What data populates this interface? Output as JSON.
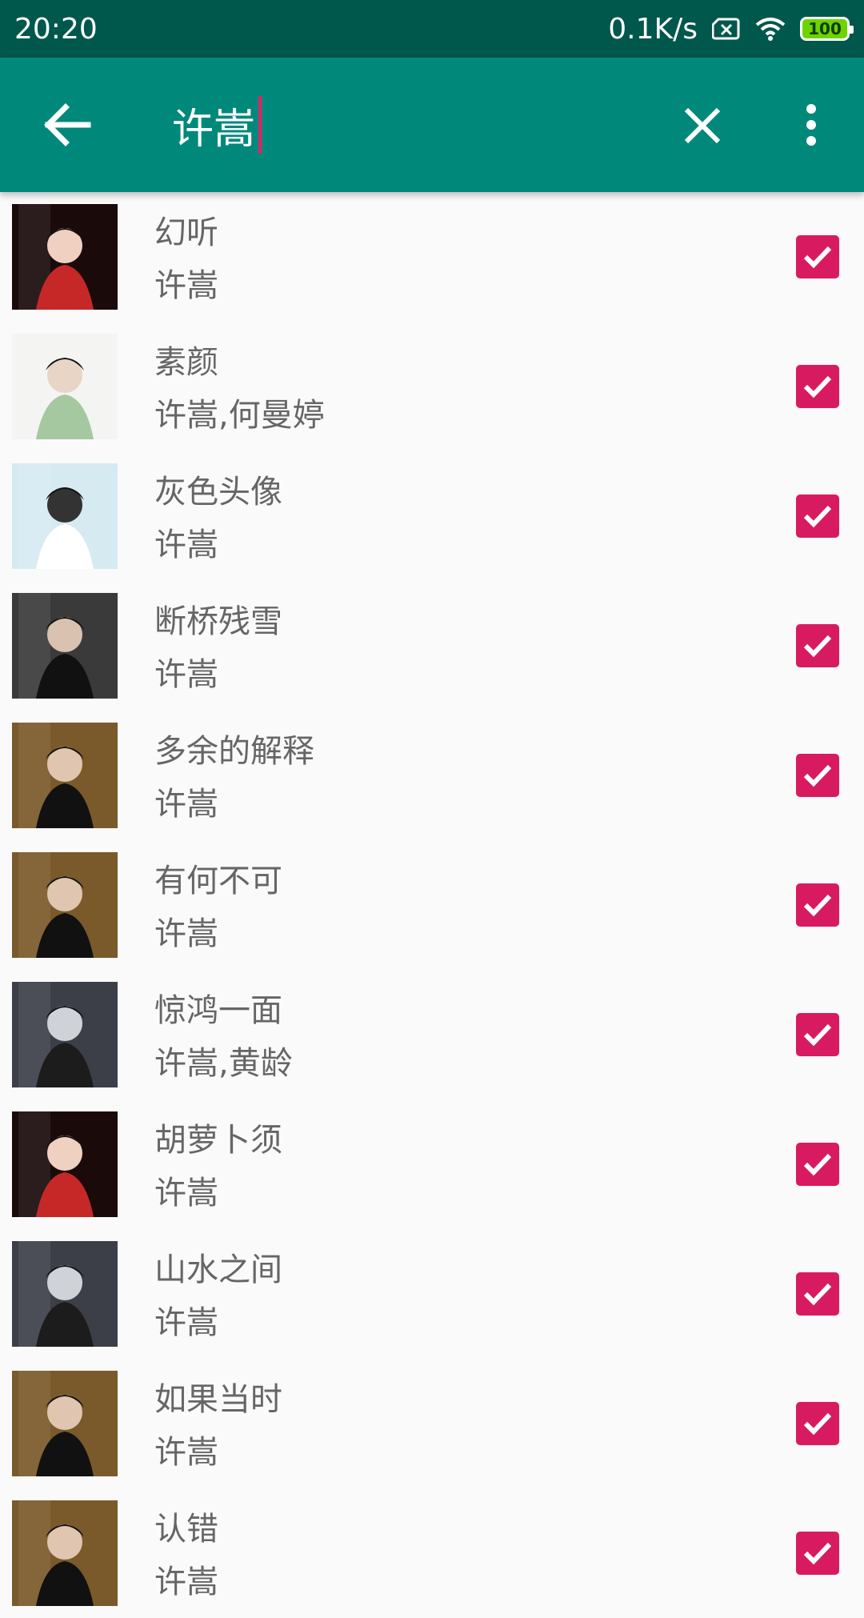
{
  "status_bar": {
    "time": "20:20",
    "network_speed": "0.1K/s",
    "battery": "100",
    "icons": [
      "sim-off-icon",
      "wifi-icon",
      "battery-icon"
    ]
  },
  "toolbar": {
    "query": "许嵩",
    "icons": [
      "back-arrow-icon",
      "close-icon",
      "more-vert-icon"
    ]
  },
  "colors": {
    "status_bar": "#00574b",
    "toolbar": "#00897b",
    "checkbox": "#d81b60",
    "text": "#666666",
    "background": "#fafafa"
  },
  "songs": [
    {
      "title": "幻听",
      "artist": "许嵩",
      "checked": true
    },
    {
      "title": "素颜",
      "artist": "许嵩,何曼婷",
      "checked": true
    },
    {
      "title": "灰色头像",
      "artist": "许嵩",
      "checked": true
    },
    {
      "title": "断桥残雪",
      "artist": "许嵩",
      "checked": true
    },
    {
      "title": "多余的解释",
      "artist": "许嵩",
      "checked": true
    },
    {
      "title": "有何不可",
      "artist": "许嵩",
      "checked": true
    },
    {
      "title": "惊鸿一面",
      "artist": "许嵩,黄龄",
      "checked": true
    },
    {
      "title": "胡萝卜须",
      "artist": "许嵩",
      "checked": true
    },
    {
      "title": "山水之间",
      "artist": "许嵩",
      "checked": true
    },
    {
      "title": "如果当时",
      "artist": "许嵩",
      "checked": true
    },
    {
      "title": "认错",
      "artist": "许嵩",
      "checked": true
    }
  ]
}
